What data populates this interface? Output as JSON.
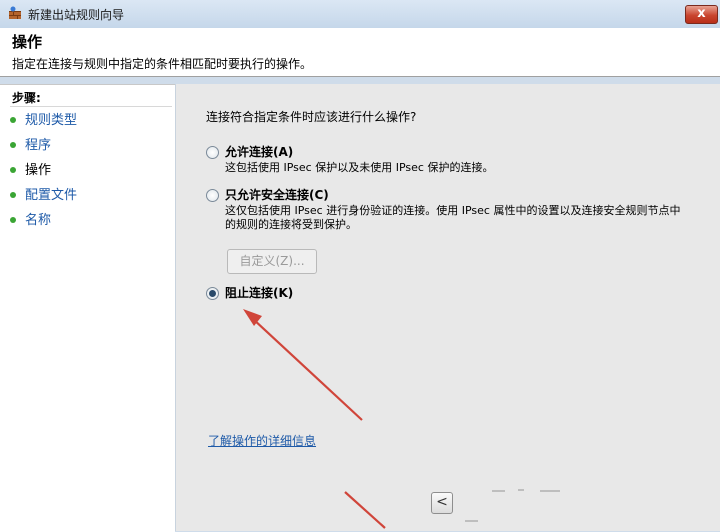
{
  "window": {
    "title": "新建出站规则向导",
    "close_glyph": "x"
  },
  "header": {
    "title": "操作",
    "description": "指定在连接与规则中指定的条件相匹配时要执行的操作。"
  },
  "sidebar": {
    "steps_label": "步骤:",
    "items": [
      {
        "label": "规则类型"
      },
      {
        "label": "程序"
      },
      {
        "label": "操作"
      },
      {
        "label": "配置文件"
      },
      {
        "label": "名称"
      }
    ],
    "active_index": 2
  },
  "main": {
    "question": "连接符合指定条件时应该进行什么操作?",
    "options": [
      {
        "label": "允许连接(A)",
        "description": "这包括使用 IPsec 保护以及未使用 IPsec 保护的连接。",
        "checked": false
      },
      {
        "label": "只允许安全连接(C)",
        "description": "这仅包括使用 IPsec 进行身份验证的连接。使用 IPsec 属性中的设置以及连接安全规则节点中的规则的连接将受到保护。",
        "checked": false
      },
      {
        "label": "阻止连接(K)",
        "description": "",
        "checked": true
      }
    ],
    "customize_button": "自定义(Z)...",
    "learn_more_link": "了解操作的详细信息",
    "back_button_glyph": "<"
  },
  "colors": {
    "link": "#1e5aa8",
    "step_bullet": "#3aa534",
    "annotation_arrow": "#d0453a",
    "close_button": "#c9452f"
  }
}
